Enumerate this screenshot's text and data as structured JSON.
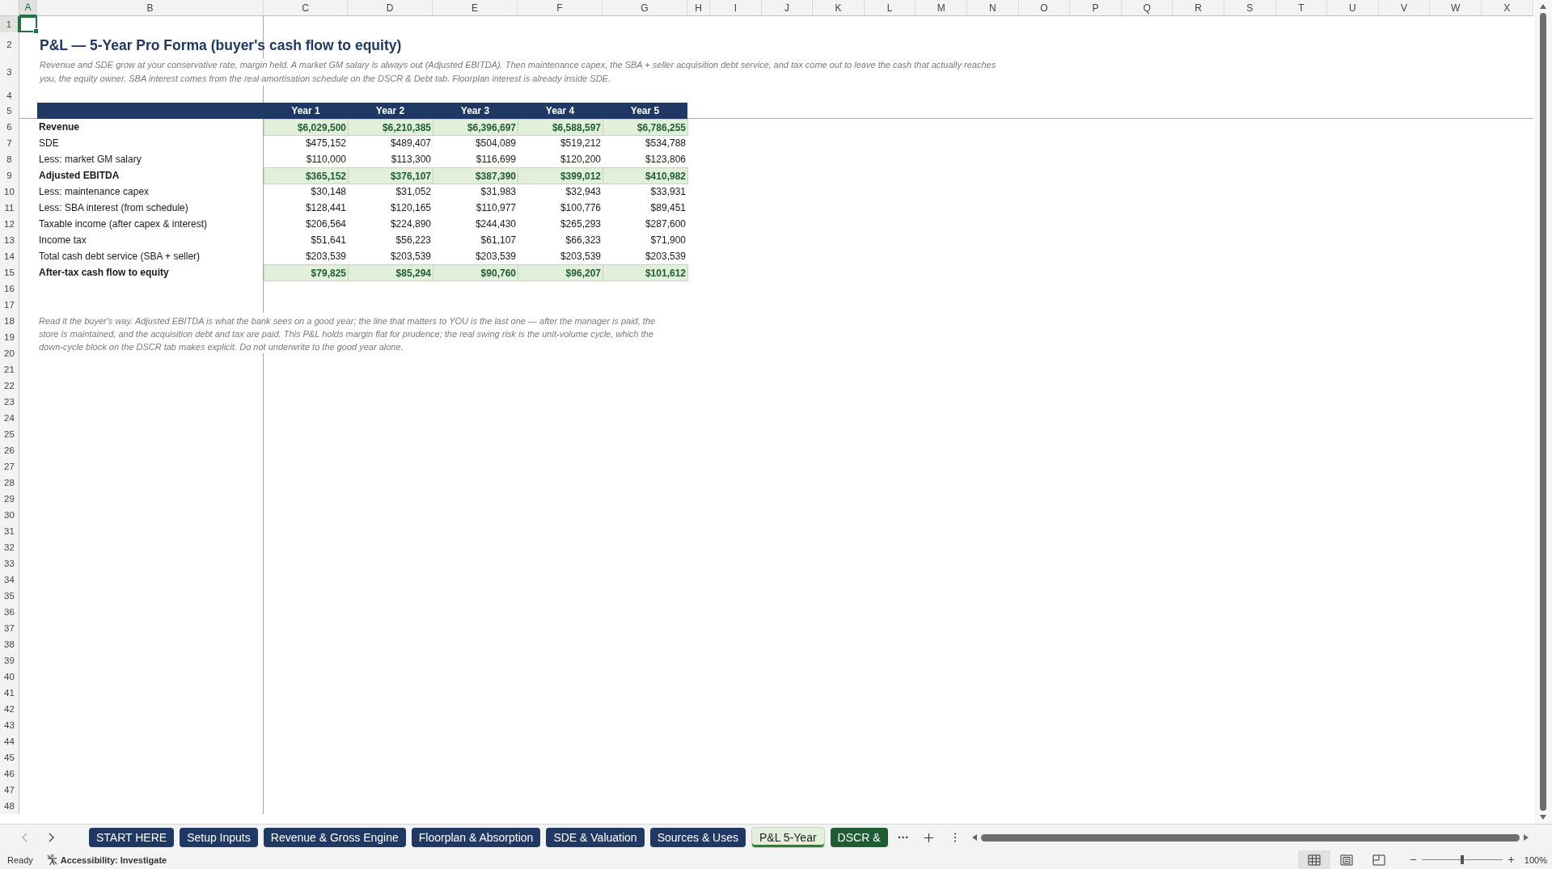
{
  "columns": [
    {
      "label": "A",
      "selected": true
    },
    {
      "label": "B",
      "selected": false
    },
    {
      "label": "C",
      "selected": false
    },
    {
      "label": "D",
      "selected": false
    },
    {
      "label": "E",
      "selected": false
    },
    {
      "label": "F",
      "selected": false
    },
    {
      "label": "G",
      "selected": false
    },
    {
      "label": "H",
      "selected": false
    },
    {
      "label": "I",
      "selected": false
    },
    {
      "label": "J",
      "selected": false
    },
    {
      "label": "K",
      "selected": false
    },
    {
      "label": "L",
      "selected": false
    },
    {
      "label": "M",
      "selected": false
    },
    {
      "label": "N",
      "selected": false
    },
    {
      "label": "O",
      "selected": false
    },
    {
      "label": "P",
      "selected": false
    },
    {
      "label": "Q",
      "selected": false
    },
    {
      "label": "R",
      "selected": false
    },
    {
      "label": "S",
      "selected": false
    },
    {
      "label": "T",
      "selected": false
    },
    {
      "label": "U",
      "selected": false
    },
    {
      "label": "V",
      "selected": false
    },
    {
      "label": "W",
      "selected": false
    },
    {
      "label": "X",
      "selected": false
    }
  ],
  "rows": [
    {
      "label": "1",
      "selected": true
    },
    {
      "label": "2",
      "selected": false
    },
    {
      "label": "3",
      "selected": false
    },
    {
      "label": "4",
      "selected": false
    },
    {
      "label": "5",
      "selected": false
    },
    {
      "label": "6",
      "selected": false
    },
    {
      "label": "7",
      "selected": false
    },
    {
      "label": "8",
      "selected": false
    },
    {
      "label": "9",
      "selected": false
    },
    {
      "label": "10",
      "selected": false
    },
    {
      "label": "11",
      "selected": false
    },
    {
      "label": "12",
      "selected": false
    },
    {
      "label": "13",
      "selected": false
    },
    {
      "label": "14",
      "selected": false
    },
    {
      "label": "15",
      "selected": false
    },
    {
      "label": "16",
      "selected": false
    },
    {
      "label": "17",
      "selected": false
    },
    {
      "label": "18",
      "selected": false
    },
    {
      "label": "19",
      "selected": false
    },
    {
      "label": "20",
      "selected": false
    },
    {
      "label": "21",
      "selected": false
    },
    {
      "label": "22",
      "selected": false
    },
    {
      "label": "23",
      "selected": false
    },
    {
      "label": "24",
      "selected": false
    },
    {
      "label": "25",
      "selected": false
    },
    {
      "label": "26",
      "selected": false
    },
    {
      "label": "27",
      "selected": false
    },
    {
      "label": "28",
      "selected": false
    },
    {
      "label": "29",
      "selected": false
    },
    {
      "label": "30",
      "selected": false
    },
    {
      "label": "31",
      "selected": false
    },
    {
      "label": "32",
      "selected": false
    },
    {
      "label": "33",
      "selected": false
    },
    {
      "label": "34",
      "selected": false
    },
    {
      "label": "35",
      "selected": false
    },
    {
      "label": "36",
      "selected": false
    },
    {
      "label": "37",
      "selected": false
    },
    {
      "label": "38",
      "selected": false
    },
    {
      "label": "39",
      "selected": false
    },
    {
      "label": "40",
      "selected": false
    },
    {
      "label": "41",
      "selected": false
    },
    {
      "label": "42",
      "selected": false
    },
    {
      "label": "43",
      "selected": false
    },
    {
      "label": "44",
      "selected": false
    },
    {
      "label": "45",
      "selected": false
    },
    {
      "label": "46",
      "selected": false
    },
    {
      "label": "47",
      "selected": false
    },
    {
      "label": "48",
      "selected": false
    }
  ],
  "title": "P&L — 5-Year Pro Forma (buyer's cash flow to equity)",
  "subtitle": "Revenue and SDE grow at your conservative rate, margin held. A market GM salary is always out (Adjusted EBITDA). Then maintenance capex, the SBA + seller acquisition debt service, and tax come out to leave the cash that actually reaches you, the equity owner. SBA interest comes from the real amortisation schedule on the DSCR & Debt tab. Floorplan interest is already inside SDE.",
  "table": {
    "header": [
      "Year 1",
      "Year 2",
      "Year 3",
      "Year 4",
      "Year 5"
    ],
    "rows": [
      {
        "label": "Revenue",
        "kind": "total",
        "values": [
          "$6,029,500",
          "$6,210,385",
          "$6,396,697",
          "$6,588,597",
          "$6,786,255"
        ]
      },
      {
        "label": "SDE",
        "kind": "line",
        "values": [
          "$475,152",
          "$489,407",
          "$504,089",
          "$519,212",
          "$534,788"
        ]
      },
      {
        "label": "Less: market GM salary",
        "kind": "line",
        "values": [
          "$110,000",
          "$113,300",
          "$116,699",
          "$120,200",
          "$123,806"
        ]
      },
      {
        "label": "Adjusted EBITDA",
        "kind": "total",
        "values": [
          "$365,152",
          "$376,107",
          "$387,390",
          "$399,012",
          "$410,982"
        ]
      },
      {
        "label": "Less: maintenance capex",
        "kind": "line",
        "values": [
          "$30,148",
          "$31,052",
          "$31,983",
          "$32,943",
          "$33,931"
        ]
      },
      {
        "label": "Less: SBA interest (from schedule)",
        "kind": "line",
        "values": [
          "$128,441",
          "$120,165",
          "$110,977",
          "$100,776",
          "$89,451"
        ]
      },
      {
        "label": "Taxable income (after capex & interest)",
        "kind": "line",
        "values": [
          "$206,564",
          "$224,890",
          "$244,430",
          "$265,293",
          "$287,600"
        ]
      },
      {
        "label": "Income tax",
        "kind": "line",
        "values": [
          "$51,641",
          "$56,223",
          "$61,107",
          "$66,323",
          "$71,900"
        ]
      },
      {
        "label": "Total cash debt service (SBA + seller)",
        "kind": "line",
        "values": [
          "$203,539",
          "$203,539",
          "$203,539",
          "$203,539",
          "$203,539"
        ]
      },
      {
        "label": "After-tax cash flow to equity",
        "kind": "total",
        "values": [
          "$79,825",
          "$85,294",
          "$90,760",
          "$96,207",
          "$101,612"
        ]
      }
    ]
  },
  "note": "Read it the buyer's way. Adjusted EBITDA is what the bank sees on a good year; the line that matters to YOU is the last one — after the manager is paid, the store is maintained, and the acquisition debt and tax are paid. This P&L holds margin flat for prudence; the real swing risk is the unit-volume cycle, which the down-cycle block on the DSCR tab makes explicit. Do not underwrite to the good year alone.",
  "sheet_tabs": [
    {
      "label": "START HERE",
      "selected": false,
      "color": "#1f3864"
    },
    {
      "label": "Setup Inputs",
      "selected": false,
      "color": "#1f3864"
    },
    {
      "label": "Revenue & Gross Engine",
      "selected": false,
      "color": "#1f3864"
    },
    {
      "label": "Floorplan & Absorption",
      "selected": false,
      "color": "#1f3864"
    },
    {
      "label": "SDE & Valuation",
      "selected": false,
      "color": "#1f3864"
    },
    {
      "label": "Sources & Uses",
      "selected": false,
      "color": "#1f3864"
    },
    {
      "label": "P&L 5-Year",
      "selected": true,
      "color": "#e2efda"
    },
    {
      "label": "DSCR &",
      "selected": false,
      "color": "#1e5c33"
    }
  ],
  "tab_overflow": "···",
  "status_bar": {
    "mode": "Ready",
    "accessibility": "Accessibility: Investigate",
    "zoom": "100%",
    "zoom_slider": {
      "level": 0.5
    }
  }
}
